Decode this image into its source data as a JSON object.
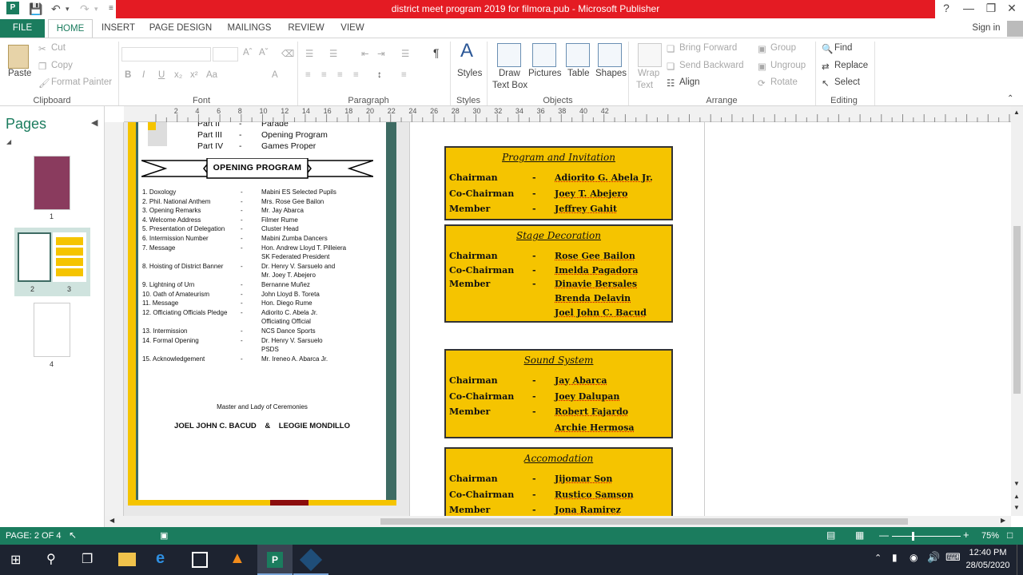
{
  "window": {
    "title": "district meet program 2019 for filmora.pub - Microsoft Publisher",
    "help": "?"
  },
  "tabs": [
    "FILE",
    "HOME",
    "INSERT",
    "PAGE DESIGN",
    "MAILINGS",
    "REVIEW",
    "VIEW"
  ],
  "signin": "Sign in",
  "ribbon": {
    "clipboard": {
      "paste": "Paste",
      "cut": "Cut",
      "copy": "Copy",
      "format_painter": "Format Painter",
      "label": "Clipboard"
    },
    "font": {
      "label": "Font",
      "bold": "B",
      "italic": "I",
      "underline": "U",
      "sub": "x₂",
      "sup": "x²",
      "case": "Aa",
      "color": "A"
    },
    "paragraph": {
      "label": "Paragraph",
      "pilcrow": "¶"
    },
    "styles": {
      "button": "Styles",
      "label": "Styles"
    },
    "objects": {
      "draw": "Draw",
      "draw2": "Text Box",
      "pictures": "Pictures",
      "table": "Table",
      "shapes": "Shapes",
      "label": "Objects"
    },
    "arrange": {
      "wrap": "Wrap",
      "wrap2": "Text",
      "bring_forward": "Bring Forward",
      "send_backward": "Send Backward",
      "align": "Align",
      "group": "Group",
      "ungroup": "Ungroup",
      "rotate": "Rotate",
      "label": "Arrange"
    },
    "editing": {
      "find": "Find",
      "replace": "Replace",
      "select": "Select",
      "label": "Editing"
    }
  },
  "pages_pane": {
    "title": "Pages",
    "thumbs": [
      "1",
      "2",
      "3",
      "4"
    ]
  },
  "ruler_ticks": [
    "2",
    "4",
    "6",
    "8",
    "10",
    "12",
    "14",
    "16",
    "18",
    "20",
    "22",
    "24",
    "26",
    "28",
    "30",
    "32",
    "34",
    "36",
    "38",
    "40",
    "42"
  ],
  "document": {
    "parts": [
      {
        "part": "Part II",
        "dash": "-",
        "name": "Parade"
      },
      {
        "part": "Part III",
        "dash": "-",
        "name": "Opening Program"
      },
      {
        "part": "Part IV",
        "dash": "-",
        "name": "Games Proper"
      }
    ],
    "banner": "OPENING PROGRAM",
    "program": [
      {
        "item": "1. Doxology",
        "dash": "-",
        "who": "Mabini ES Selected Pupils"
      },
      {
        "item": "2. Phil. National Anthem",
        "dash": "-",
        "who": "Mrs. Rose Gee Bailon"
      },
      {
        "item": "3. Opening Remarks",
        "dash": "-",
        "who": "Mr. Jay Abarca"
      },
      {
        "item": "4. Welcome Address",
        "dash": "-",
        "who": "Filmer Rume"
      },
      {
        "item": "5. Presentation of Delegation",
        "dash": "-",
        "who": "Cluster Head"
      },
      {
        "item": "6. Intermission Number",
        "dash": "-",
        "who": "Mabini Zumba Dancers"
      },
      {
        "item": "7. Message",
        "dash": "-",
        "who": "Hon. Andrew Lloyd T. Pilleiera"
      },
      {
        "item": "",
        "dash": "",
        "who": "SK Federated President"
      },
      {
        "item": "8. Hoisting of District Banner",
        "dash": "-",
        "who": "Dr. Henry V. Sarsuelo and"
      },
      {
        "item": "",
        "dash": "",
        "who": "Mr. Joey T. Abejero"
      },
      {
        "item": "9. Lightning of Urn",
        "dash": "-",
        "who": "Bernanne Muñez"
      },
      {
        "item": "10. Oath of Amateurism",
        "dash": "-",
        "who": "John Lloyd B. Toreta"
      },
      {
        "item": "11. Message",
        "dash": "-",
        "who": "Hon. Diego Rume"
      },
      {
        "item": "12. Officiating Officials Pledge",
        "dash": "-",
        "who": "Adiorito C. Abela Jr."
      },
      {
        "item": "",
        "dash": "",
        "who": "Officiating Official"
      },
      {
        "item": "13. Intermission",
        "dash": "-",
        "who": "NCS Dance Sports"
      },
      {
        "item": "14. Formal Opening",
        "dash": "-",
        "who": "Dr. Henry V. Sarsuelo"
      },
      {
        "item": "",
        "dash": "",
        "who": "PSDS"
      },
      {
        "item": "15. Acknowledgement",
        "dash": "-",
        "who": "Mr. Ireneo A. Abarca Jr."
      }
    ],
    "emcee_label": "Master and Lady of Ceremonies",
    "emcees": "JOEL JOHN C. BACUD    &    LEOGIE MONDILLO",
    "committees": [
      {
        "title": "Program and Invitation",
        "rows": [
          [
            "Chairman",
            "-",
            "Adiorito G. Abela Jr."
          ],
          [
            "Co-Chairman",
            "-",
            "Joey T. Abejero"
          ],
          [
            "Member",
            "-",
            "Jeffrey Gahit"
          ]
        ]
      },
      {
        "title": "Stage Decoration",
        "rows": [
          [
            "Chairman",
            "-",
            "Rose Gee Bailon"
          ],
          [
            "Co-Chairman",
            "-",
            "Imelda Pagadora"
          ],
          [
            "Member",
            "-",
            "Dinavie Bersales"
          ],
          [
            "",
            "",
            "Brenda Delavin"
          ],
          [
            "",
            "",
            "Joel John C. Bacud"
          ]
        ]
      },
      {
        "title": "Sound System",
        "rows": [
          [
            "Chairman",
            "-",
            "Jay Abarca"
          ],
          [
            "Co-Chairman",
            "-",
            "Joey Dalupan"
          ],
          [
            "Member",
            "-",
            "Robert Fajardo"
          ],
          [
            "",
            "",
            "Archie Hermosa"
          ]
        ]
      },
      {
        "title": "Accomodation",
        "rows": [
          [
            "Chairman",
            "-",
            "Jijomar Son"
          ],
          [
            "Co-Chairman",
            "-",
            "Rustico Samson"
          ],
          [
            "Member",
            "-",
            "Jona Ramirez"
          ]
        ]
      }
    ]
  },
  "status": {
    "page": "PAGE: 2 OF 4",
    "zoom": "75%"
  },
  "taskbar": {
    "time": "12:40 PM",
    "date": "28/05/2020"
  },
  "colors": {
    "accent": "#1b7c5e",
    "title_red": "#e41b23",
    "box_yellow": "#f5c400",
    "frame_teal": "#3e6b63"
  }
}
